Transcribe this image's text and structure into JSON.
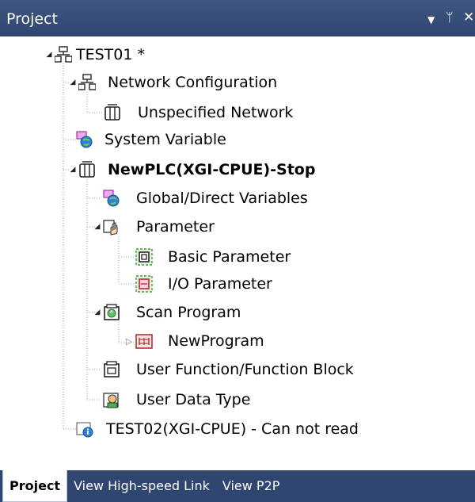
{
  "panel": {
    "title": "Project",
    "dropdown_icon": "chevron-down-icon",
    "pin_icon": "pin-icon",
    "close_icon": "close-icon"
  },
  "tree": {
    "root": "TEST01 *",
    "network_configuration": "Network Configuration",
    "unspecified_network": "Unspecified Network",
    "system_variable": "System Variable",
    "plc": "NewPLC(XGI-CPUE)-Stop",
    "global_direct_variables": "Global/Direct Variables",
    "parameter": "Parameter",
    "basic_parameter": "Basic Parameter",
    "io_parameter": "I/O Parameter",
    "scan_program": "Scan Program",
    "new_program": "NewProgram",
    "user_function_block": "User Function/Function Block",
    "user_data_type": "User Data Type",
    "test02": "TEST02(XGI-CPUE) - Can not read"
  },
  "tabs": [
    {
      "label": "Project",
      "active": true
    },
    {
      "label": "View High-speed Link",
      "active": false
    },
    {
      "label": "View P2P",
      "active": false
    }
  ],
  "colors": {
    "header_bg": "#2f4670",
    "tab_bar_bg": "#2f4670",
    "active_tab_bg": "#ffffff"
  }
}
